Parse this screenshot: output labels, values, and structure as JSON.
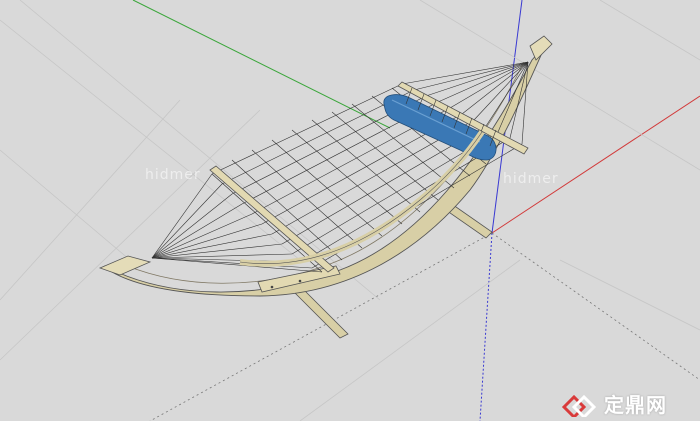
{
  "viewport": {
    "background_color": "#d9d9d9"
  },
  "model": {
    "object": "hammock",
    "hammock_pillow_color": "#3a78b5",
    "frame_wood_color": "#d8cfa6",
    "string_color": "#333333"
  },
  "axes": {
    "green_axis_color": "#3aa63a",
    "red_axis_color": "#d23a3a",
    "blue_axis_color": "#3a3ad2"
  },
  "watermarks": {
    "center_text": "hidmer",
    "right_text": "hidmer"
  },
  "brand": {
    "logo_icon": "zhulong-logo-icon",
    "text": "定鼎网",
    "logo_color": "#d93a3a"
  }
}
